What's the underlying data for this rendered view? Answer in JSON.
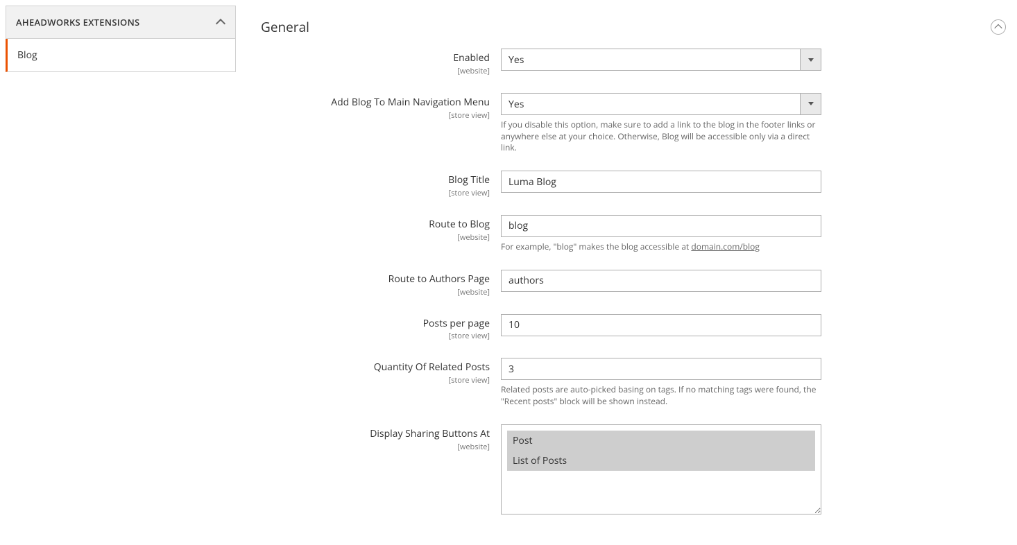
{
  "sidebar": {
    "header": "AHEADWORKS EXTENSIONS",
    "items": [
      {
        "label": "Blog"
      }
    ]
  },
  "section_title": "General",
  "fields": {
    "enabled": {
      "label": "Enabled",
      "scope": "[website]",
      "value": "Yes"
    },
    "add_nav": {
      "label": "Add Blog To Main Navigation Menu",
      "scope": "[store view]",
      "value": "Yes",
      "note": "If you disable this option, make sure to add a link to the blog in the footer links or anywhere else at your choice. Otherwise, Blog will be accessible only via a direct link."
    },
    "blog_title": {
      "label": "Blog Title",
      "scope": "[store view]",
      "value": "Luma Blog"
    },
    "route_blog": {
      "label": "Route to Blog",
      "scope": "[website]",
      "value": "blog",
      "note_prefix": "For example, \"blog\" makes the blog accessible at ",
      "note_link": "domain.com/blog"
    },
    "route_authors": {
      "label": "Route to Authors Page",
      "scope": "[website]",
      "value": "authors"
    },
    "posts_per_page": {
      "label": "Posts per page",
      "scope": "[store view]",
      "value": "10"
    },
    "related_qty": {
      "label": "Quantity Of Related Posts",
      "scope": "[store view]",
      "value": "3",
      "note": "Related posts are auto-picked basing on tags. If no matching tags were found, the \"Recent posts\" block will be shown instead."
    },
    "sharing": {
      "label": "Display Sharing Buttons At",
      "scope": "[website]",
      "options": [
        {
          "label": "Post",
          "selected": true
        },
        {
          "label": "List of Posts",
          "selected": true
        }
      ]
    }
  }
}
